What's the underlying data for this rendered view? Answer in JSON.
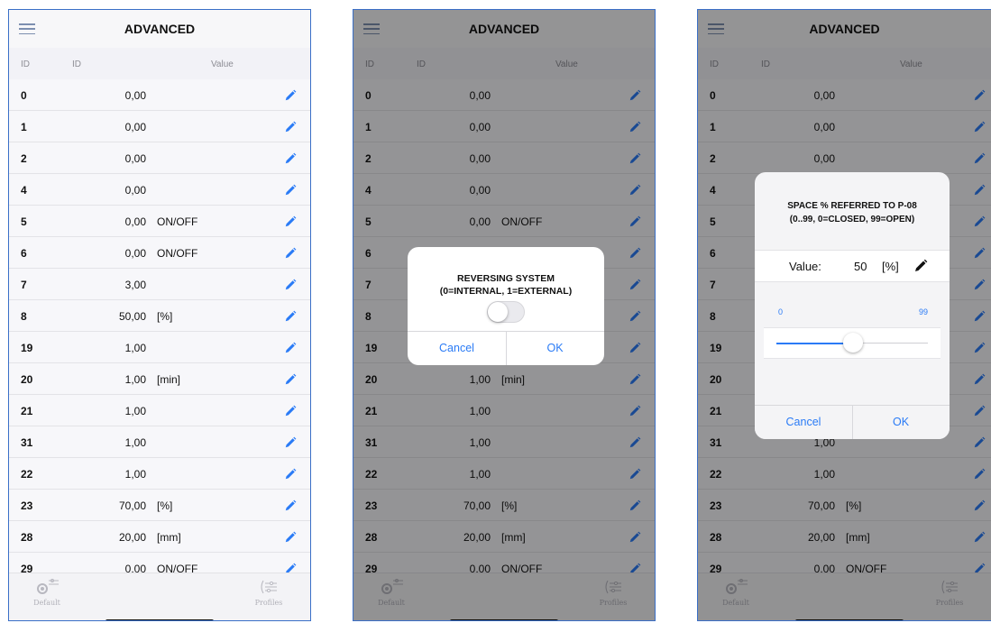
{
  "header": {
    "title": "ADVANCED"
  },
  "columns": {
    "id1": "ID",
    "id2": "ID",
    "value": "Value"
  },
  "rows": [
    {
      "id": "0",
      "value": "0,00",
      "unit": ""
    },
    {
      "id": "1",
      "value": "0,00",
      "unit": ""
    },
    {
      "id": "2",
      "value": "0,00",
      "unit": ""
    },
    {
      "id": "4",
      "value": "0,00",
      "unit": ""
    },
    {
      "id": "5",
      "value": "0,00",
      "unit": "ON/OFF"
    },
    {
      "id": "6",
      "value": "0,00",
      "unit": "ON/OFF"
    },
    {
      "id": "7",
      "value": "3,00",
      "unit": ""
    },
    {
      "id": "8",
      "value": "50,00",
      "unit": "[%]"
    },
    {
      "id": "19",
      "value": "1,00",
      "unit": ""
    },
    {
      "id": "20",
      "value": "1,00",
      "unit": "[min]"
    },
    {
      "id": "21",
      "value": "1,00",
      "unit": ""
    },
    {
      "id": "31",
      "value": "1,00",
      "unit": ""
    },
    {
      "id": "22",
      "value": "1,00",
      "unit": ""
    },
    {
      "id": "23",
      "value": "70,00",
      "unit": "[%]"
    },
    {
      "id": "28",
      "value": "20,00",
      "unit": "[mm]"
    },
    {
      "id": "29",
      "value": "0,00",
      "unit": "ON/OFF"
    }
  ],
  "tabs": {
    "default": "Default",
    "profiles": "Profiles"
  },
  "dialog_toggle": {
    "title_line1": "REVERSING SYSTEM",
    "title_line2": "(0=INTERNAL, 1=EXTERNAL)",
    "toggle_on": false,
    "cancel": "Cancel",
    "ok": "OK"
  },
  "dialog_slider": {
    "title_line1": "SPACE % REFERRED TO P-08",
    "title_line2": "(0..99, 0=CLOSED, 99=OPEN)",
    "value_label": "Value:",
    "value": "50",
    "unit": "[%]",
    "min": "0",
    "max": "99",
    "slider_value": 50,
    "cancel": "Cancel",
    "ok": "OK"
  },
  "colors": {
    "accent": "#2a7bf6",
    "frame": "#3a6fc7"
  },
  "icons": {
    "menu": "menu-icon",
    "edit": "pencil-icon",
    "default_tab": "gear-sliders-icon",
    "profiles_tab": "profiles-sliders-icon"
  }
}
